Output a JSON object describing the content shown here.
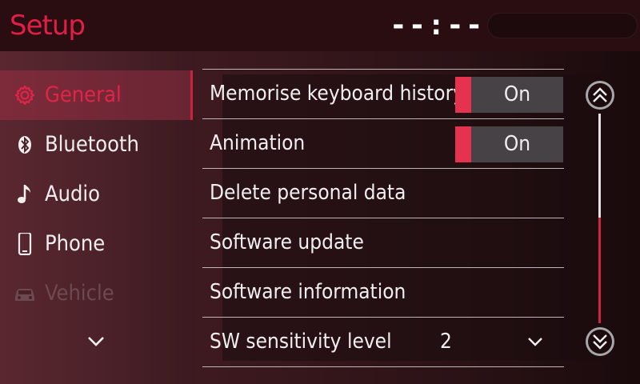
{
  "header": {
    "title": "Setup",
    "clock": "--:--"
  },
  "sidebar": {
    "items": [
      {
        "label": "General",
        "icon": "gear-icon",
        "state": "active"
      },
      {
        "label": "Bluetooth",
        "icon": "bluetooth-icon",
        "state": "normal"
      },
      {
        "label": "Audio",
        "icon": "music-note-icon",
        "state": "normal"
      },
      {
        "label": "Phone",
        "icon": "phone-icon",
        "state": "normal"
      },
      {
        "label": "Vehicle",
        "icon": "car-icon",
        "state": "disabled"
      }
    ],
    "more_icon": "chevron-down-icon"
  },
  "settings": {
    "rows": [
      {
        "label": "Memorise keyboard history",
        "control": "toggle",
        "value": "On"
      },
      {
        "label": "Animation",
        "control": "toggle",
        "value": "On"
      },
      {
        "label": "Delete personal data",
        "control": "none"
      },
      {
        "label": "Software update",
        "control": "none"
      },
      {
        "label": "Software information",
        "control": "none"
      },
      {
        "label": "SW sensitivity level",
        "control": "dropdown",
        "value": "2"
      }
    ]
  },
  "colors": {
    "accent": "#e01f46",
    "toggle_on": "#e5324f",
    "background": "#2c1216"
  }
}
